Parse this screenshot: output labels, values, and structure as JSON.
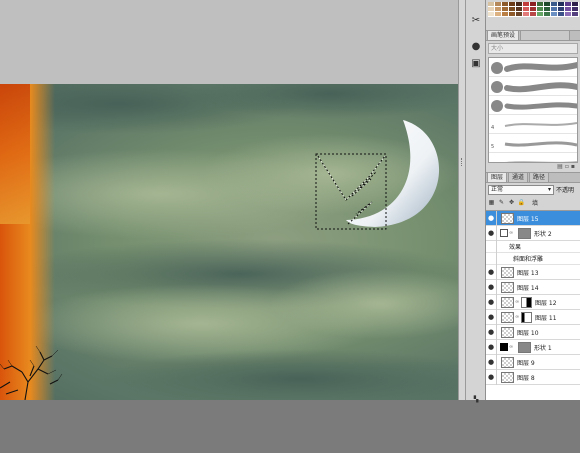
{
  "colors": {
    "workspace": "#7b7b7b",
    "panel": "#d4d4d4",
    "selection": "#3b8edc"
  },
  "toolstrip": {
    "icons": [
      "tools-icon",
      "brush-icon",
      "stamp-icon"
    ]
  },
  "swatches": [
    "#d6c2a0",
    "#b5895a",
    "#8c5a2b",
    "#6b3a16",
    "#4a2a1a",
    "#c23b3b",
    "#8c1f1f",
    "#3b6e3b",
    "#1f4a2b",
    "#3b5a8c",
    "#1f2e5a",
    "#5a3b8c",
    "#2e1f4a",
    "#e7d3b8",
    "#c99a6a",
    "#a06a36",
    "#7a4a20",
    "#5a3520",
    "#d45a5a",
    "#a03030",
    "#4f8a4f",
    "#2d5e3a",
    "#4f73a8",
    "#2d3f72",
    "#73509f",
    "#402c66",
    "#f0e3cd",
    "#ddb283",
    "#b97f45",
    "#8e5a2a",
    "#6c4428",
    "#e37a7a",
    "#b84848",
    "#65a565",
    "#3d7649",
    "#6a90c3",
    "#3c5288",
    "#8b6cb5",
    "#55407f"
  ],
  "brush_panel": {
    "tabs": [
      {
        "label": "画笔预设",
        "active": true
      },
      {
        "label": "",
        "active": false
      }
    ],
    "search_placeholder": "大小",
    "brushes": [
      {
        "num": ""
      },
      {
        "num": ""
      },
      {
        "num": ""
      },
      {
        "num": "4"
      },
      {
        "num": "5"
      },
      {
        "num": "4"
      }
    ]
  },
  "layers_panel": {
    "tabs": [
      {
        "label": "图层",
        "active": true
      },
      {
        "label": "通道",
        "active": false
      },
      {
        "label": "路径",
        "active": false
      }
    ],
    "blend_mode": "正常",
    "opacity_label": "不透明",
    "fill_label": "填",
    "layers": [
      {
        "name": "图层 15",
        "thumb": "checker",
        "mask": "",
        "selected": true
      },
      {
        "name": "形状 2",
        "thumb": "grey",
        "mask": "",
        "selected": false,
        "lock_box": true
      },
      {
        "name": "图层 13",
        "thumb": "checker",
        "mask": "",
        "selected": false
      },
      {
        "name": "图层 14",
        "thumb": "checker",
        "mask": "",
        "selected": false
      },
      {
        "name": "图层 12",
        "thumb": "checker",
        "mask": "black-right",
        "selected": false
      },
      {
        "name": "图层 11",
        "thumb": "checker",
        "mask": "white",
        "selected": false
      },
      {
        "name": "图层 10",
        "thumb": "checker",
        "mask": "",
        "selected": false
      },
      {
        "name": "形状 1",
        "thumb": "grey",
        "mask": "",
        "selected": false,
        "black_chip": true
      },
      {
        "name": "图层 9",
        "thumb": "checker",
        "mask": "",
        "selected": false
      },
      {
        "name": "图层 8",
        "thumb": "checker",
        "mask": "",
        "selected": false
      }
    ],
    "effects": {
      "group_label": "效果",
      "items": [
        "斜面和浮雕"
      ]
    }
  }
}
